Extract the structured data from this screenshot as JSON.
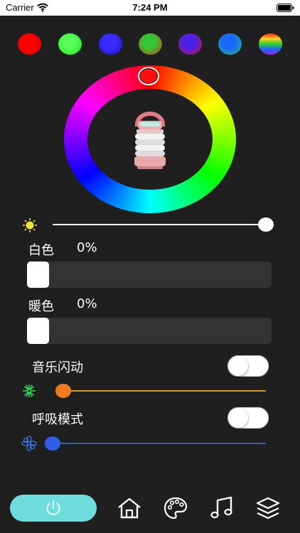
{
  "status_bar": {
    "carrier": "Carrier",
    "time": "7:24 PM"
  },
  "presets": [
    {
      "name": "red",
      "colors": [
        "#ff0000",
        "#d00000"
      ]
    },
    {
      "name": "green",
      "colors": [
        "#55ff55",
        "#20e020"
      ]
    },
    {
      "name": "blue",
      "colors": [
        "#3a2cff",
        "#1a10c8"
      ]
    },
    {
      "name": "green-red",
      "colors": [
        "#33c833",
        "#d03020"
      ]
    },
    {
      "name": "blue-red",
      "colors": [
        "#4a20e8",
        "#c81830"
      ]
    },
    {
      "name": "blue-green",
      "colors": [
        "#1a66ff",
        "#20c86a"
      ]
    },
    {
      "name": "rainbow",
      "colors": [
        "#ff2020",
        "#ffd020",
        "#30d030",
        "#2060ff",
        "#a020f0"
      ]
    }
  ],
  "color_wheel": {
    "selected_color": "#ff1010"
  },
  "brightness": {
    "value_percent": 100
  },
  "white": {
    "label": "白色",
    "value": "0%"
  },
  "warm": {
    "label": "暖色",
    "value": "0%"
  },
  "music": {
    "label": "音乐闪动",
    "enabled": false,
    "level_fraction": 0.04,
    "color": "#f07a1e"
  },
  "breath": {
    "label": "呼吸模式",
    "enabled": false,
    "level_fraction": 0.0,
    "color": "#2f5ee8"
  },
  "bottom_bar": {
    "power_color": "#6fdcdc",
    "icons": [
      "home-icon",
      "palette-icon",
      "music-note-icon",
      "layers-icon"
    ]
  }
}
